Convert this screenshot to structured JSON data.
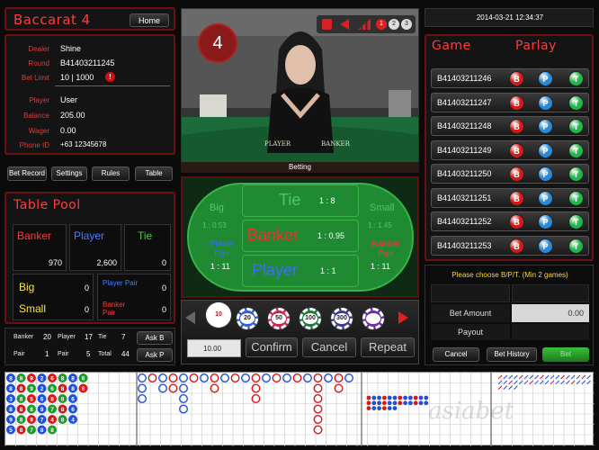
{
  "header": {
    "title": "Baccarat 4",
    "home_label": "Home",
    "datetime": "2014-03-21 12:34:37"
  },
  "info": {
    "rows": [
      {
        "label": "Dealer",
        "value": "Shine"
      },
      {
        "label": "Round",
        "value": "B41403211245"
      },
      {
        "label": "Bet Limit",
        "value": "10 | 1000"
      },
      {
        "label": "Player",
        "value": "User"
      },
      {
        "label": "Balance",
        "value": "205.00"
      },
      {
        "label": "Wager",
        "value": "0.00"
      },
      {
        "label": "Phone ID",
        "value": "+63 12345678"
      }
    ],
    "limit_badge": "!"
  },
  "buttons_left": [
    "Bet Record",
    "Settings",
    "Rules",
    "Table"
  ],
  "video": {
    "countdown": "4",
    "caption": "Betting",
    "felt_labels": [
      "PLAYER",
      "BANKER"
    ],
    "controls": [
      "1",
      "2",
      "3"
    ]
  },
  "table_pool": {
    "title": "Table Pool",
    "banker_label": "Banker",
    "banker_value": "970",
    "player_label": "Player",
    "player_value": "2,600",
    "tie_label": "Tie",
    "tie_value": "0",
    "big_label": "Big",
    "big_value": "0",
    "small_label": "Small",
    "small_value": "0",
    "ppair_label": "Player Pair",
    "ppair_value": "0",
    "bpair_label": "Banker Pair",
    "bpair_value": "0"
  },
  "stats": {
    "banker_label": "Banker",
    "banker": "20",
    "player_label": "Player",
    "player": "17",
    "tie_label": "Tie",
    "tie": "7",
    "bpair_label": "Pair",
    "bpair": "1",
    "ppair_label": "Pair",
    "ppair": "5",
    "total_label": "Total",
    "total": "44",
    "ask_b": "Ask B",
    "ask_p": "Ask P"
  },
  "bet_table": {
    "tie": "Tie",
    "tie_odds": "1 : 8",
    "banker": "Banker",
    "banker_odds": "1 : 0.95",
    "player": "Player",
    "player_odds": "1 : 1",
    "big": "Big",
    "big_odds": "1 : 0.53",
    "small": "Small",
    "small_odds": "1 : 1.45",
    "ppair": "Player Pair",
    "ppair_odds": "1 : 11",
    "bpair": "Banker Pair",
    "bpair_odds": "1 : 11"
  },
  "chips": {
    "values": [
      "10",
      "20",
      "50",
      "100",
      "300",
      ""
    ],
    "colors": [
      "#ffffff",
      "#2f5fd0",
      "#c8254a",
      "#1f7a3a",
      "#3c3c8a",
      "#6a2fa0"
    ],
    "amount": "10.00",
    "confirm": "Confirm",
    "cancel": "Cancel",
    "repeat": "Repeat"
  },
  "parlay": {
    "title_a": "Game",
    "title_b": "Parlay",
    "rounds": [
      "B41403211246",
      "B41403211247",
      "B41403211248",
      "B41403211249",
      "B41403211250",
      "B41403211251",
      "B41403211252",
      "B41403211253"
    ],
    "b": "B",
    "p": "P",
    "t": "T",
    "prompt": "Please choose B/P/T. (Min 2 games)",
    "bet_amount_label": "Bet Amount",
    "bet_amount": "0.00",
    "payout_label": "Payout",
    "cancel": "Cancel",
    "history": "Bet History",
    "bet": "Bet"
  },
  "bead_road": [
    [
      "8",
      "8",
      "9",
      "2",
      "6",
      "8",
      "8",
      "6"
    ],
    [
      "8",
      "8",
      "9",
      "2",
      "6",
      "8",
      "8",
      "6"
    ],
    [
      "3",
      "8",
      "5",
      "6",
      "8",
      "8",
      "6",
      ""
    ],
    [
      "8",
      "8",
      "8",
      "9",
      "7",
      "8",
      "6",
      ""
    ],
    [
      "9",
      "8",
      "9",
      "7",
      "4",
      "8",
      "4",
      ""
    ],
    [
      "5",
      "8",
      "7",
      "8",
      "8",
      "",
      "",
      " "
    ]
  ],
  "watermark": "asiabet"
}
